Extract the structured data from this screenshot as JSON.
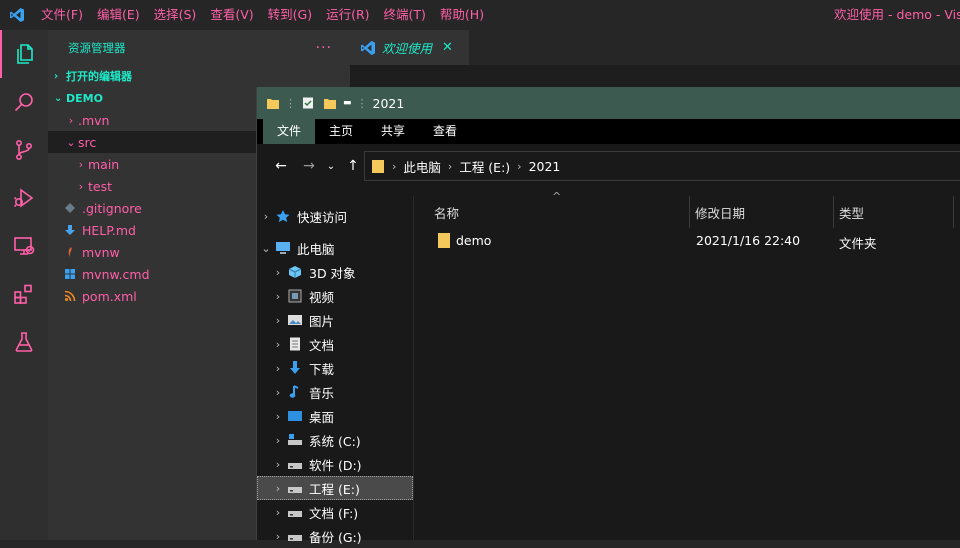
{
  "titlebar": {
    "menu": [
      "文件(F)",
      "编辑(E)",
      "选择(S)",
      "查看(V)",
      "转到(G)",
      "运行(R)",
      "终端(T)",
      "帮助(H)"
    ],
    "window_title": "欢迎使用 - demo - Visual Studio Code"
  },
  "activity_bar": {
    "icons": [
      "explorer-icon",
      "search-icon",
      "source-control-icon",
      "run-debug-icon",
      "remote-explorer-icon",
      "extensions-icon",
      "testing-icon"
    ]
  },
  "sidebar": {
    "header": "资源管理器",
    "more": "···",
    "open_editors": "打开的编辑器",
    "folder": "DEMO",
    "tree": [
      {
        "label": ".mvn",
        "chev": "›"
      },
      {
        "label": "src",
        "chev": "⌄"
      },
      {
        "label": "main",
        "chev": "›"
      },
      {
        "label": "test",
        "chev": "›"
      },
      {
        "label": ".gitignore"
      },
      {
        "label": "HELP.md"
      },
      {
        "label": "mvnw"
      },
      {
        "label": "mvnw.cmd"
      },
      {
        "label": "pom.xml"
      }
    ]
  },
  "editor": {
    "tab_label": "欢迎使用",
    "tab_close": "✕"
  },
  "explorer_window": {
    "title": "2021",
    "ribbon_tabs": [
      "文件",
      "主页",
      "共享",
      "查看"
    ],
    "address": [
      "此电脑",
      "工程 (E:)",
      "2021"
    ],
    "nav_tree": [
      {
        "label": "快速访问",
        "chev": "›",
        "icon": "star-icon"
      },
      {
        "label": "此电脑",
        "chev": "⌄",
        "icon": "computer-icon"
      },
      {
        "label": "3D 对象",
        "chev": "›",
        "icon": "cube-icon"
      },
      {
        "label": "视频",
        "chev": "›",
        "icon": "video-icon"
      },
      {
        "label": "图片",
        "chev": "›",
        "icon": "pictures-icon"
      },
      {
        "label": "文档",
        "chev": "›",
        "icon": "document-icon"
      },
      {
        "label": "下载",
        "chev": "›",
        "icon": "download-icon"
      },
      {
        "label": "音乐",
        "chev": "›",
        "icon": "music-icon"
      },
      {
        "label": "桌面",
        "chev": "›",
        "icon": "desktop-icon"
      },
      {
        "label": "系统 (C:)",
        "chev": "›",
        "icon": "drive-icon"
      },
      {
        "label": "软件 (D:)",
        "chev": "›",
        "icon": "drive-icon"
      },
      {
        "label": "工程 (E:)",
        "chev": "›",
        "icon": "drive-icon"
      },
      {
        "label": "文档 (F:)",
        "chev": "›",
        "icon": "drive-icon"
      },
      {
        "label": "备份 (G:)",
        "chev": "›",
        "icon": "drive-icon"
      }
    ],
    "columns": [
      "名称",
      "修改日期",
      "类型"
    ],
    "files": [
      {
        "name": "demo",
        "modified": "2021/1/16 22:40",
        "type": "文件夹"
      }
    ]
  },
  "colors": {
    "accent_pink": "#ff5fa8",
    "accent_teal": "#1de9c8",
    "explorer_titlebar": "#3d5a50"
  }
}
